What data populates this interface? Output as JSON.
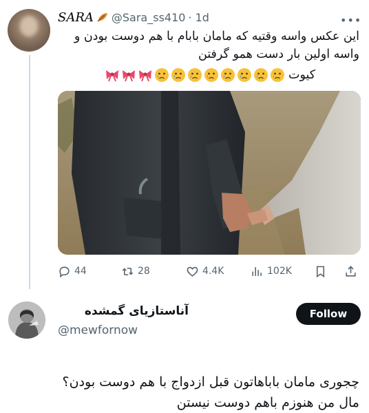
{
  "tweet": {
    "display_name": "SARA",
    "handle": "@Sara_ss410",
    "time": "· 1d",
    "text_line1": "این عکس واسه وقتیه که مامان بابام با هم دوست بودن و",
    "text_line2": "واسه اولین بار دست همو گرفتن",
    "text_line3": "کیوت",
    "emojis": [
      "bow-ribbon",
      "bow-ribbon",
      "bow-ribbon",
      "crying-face",
      "crying-face",
      "crying-face",
      "crying-face",
      "crying-face",
      "crying-face",
      "crying-face",
      "crying-face"
    ],
    "metrics": {
      "replies": "44",
      "retweets": "28",
      "likes": "4.4K",
      "views": "102K"
    }
  },
  "reply": {
    "display_name": "آناستازیای گمشده",
    "handle": "@mewfornow",
    "follow_label": "Follow",
    "text_line1": "چجوری مامان باباهاتون قبل ازدواج با هم دوست بودن؟",
    "text_line2": "مال من هنوزم باهم دوست نیستن"
  },
  "colors": {
    "text": "#0f1419",
    "muted": "#536471",
    "follow_bg": "#0f1419",
    "ribbon": "#e8496a",
    "cry_face": "#f7c23a"
  },
  "icons": [
    "more-icon",
    "reply-icon",
    "retweet-icon",
    "like-icon",
    "views-icon",
    "bookmark-icon",
    "share-icon",
    "leaf-icon"
  ]
}
